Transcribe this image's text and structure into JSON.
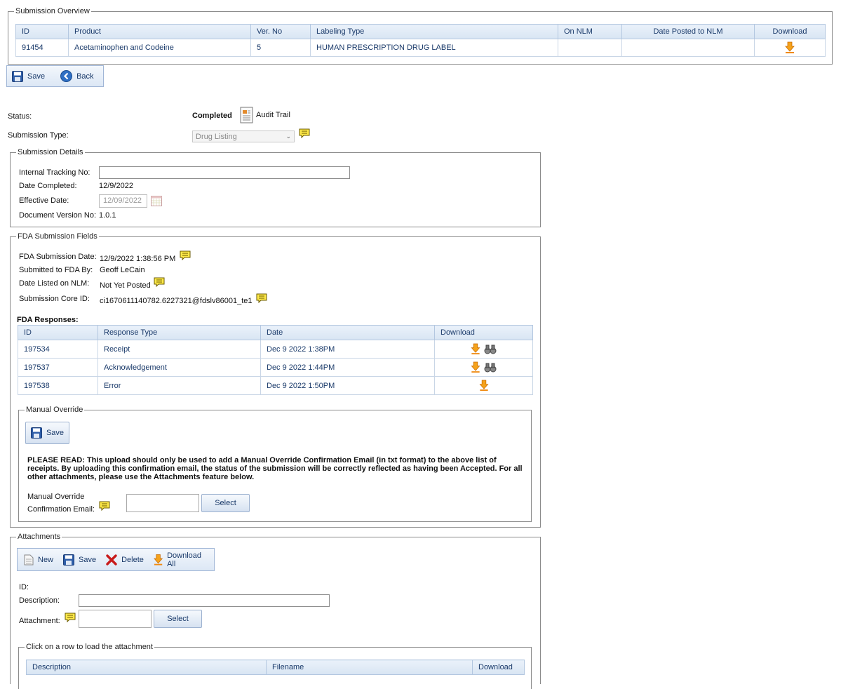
{
  "overview": {
    "legend": "Submission Overview",
    "headers": [
      "ID",
      "Product",
      "Ver. No",
      "Labeling Type",
      "On NLM",
      "Date Posted to NLM",
      "Download"
    ],
    "row": {
      "id": "91454",
      "product": "Acetaminophen and Codeine",
      "ver": "5",
      "labeling_type": "HUMAN PRESCRIPTION DRUG LABEL",
      "on_nlm": "",
      "date_posted": ""
    }
  },
  "top_toolbar": {
    "save": "Save",
    "back": "Back"
  },
  "status": {
    "label": "Status:",
    "value": "Completed",
    "audit_trail": "Audit Trail"
  },
  "submission_type": {
    "label": "Submission Type:",
    "value": "Drug Listing"
  },
  "details": {
    "legend": "Submission Details",
    "tracking_label": "Internal Tracking No:",
    "tracking_value": "",
    "date_completed_label": "Date Completed:",
    "date_completed": "12/9/2022",
    "effective_label": "Effective Date:",
    "effective_value": "12/09/2022",
    "doc_version_label": "Document Version No:",
    "doc_version": "1.0.1"
  },
  "fda": {
    "legend": "FDA Submission Fields",
    "submission_date_label": "FDA Submission Date:",
    "submission_date": "12/9/2022 1:38:56 PM",
    "submitted_by_label": "Submitted to FDA By:",
    "submitted_by": "Geoff LeCain",
    "nlm_label": "Date Listed on NLM:",
    "nlm_value": "Not Yet Posted",
    "core_id_label": "Submission Core ID:",
    "core_id": "ci1670611140782.6227321@fdslv86001_te1",
    "responses_title": "FDA Responses:",
    "responses_headers": [
      "ID",
      "Response Type",
      "Date",
      "Download"
    ],
    "responses": [
      {
        "id": "197534",
        "type": "Receipt",
        "date": "Dec 9 2022 1:38PM"
      },
      {
        "id": "197537",
        "type": "Acknowledgement",
        "date": "Dec 9 2022 1:44PM"
      },
      {
        "id": "197538",
        "type": "Error",
        "date": "Dec 9 2022 1:50PM"
      }
    ]
  },
  "manual_override": {
    "legend": "Manual Override",
    "save": "Save",
    "notice": "PLEASE READ: This upload should only be used to add a Manual Override Confirmation Email (in txt format) to the above list of receipts. By uploading this confirmation email, the status of the submission will be correctly reflected as having been Accepted. For all other attachments, please use the Attachments feature below.",
    "label_line1": "Manual Override",
    "label_line2": "Confirmation Email:",
    "select": "Select"
  },
  "attachments": {
    "legend": "Attachments",
    "toolbar": {
      "new": "New",
      "save": "Save",
      "delete": "Delete",
      "download_all": "Download All"
    },
    "id_label": "ID:",
    "description_label": "Description:",
    "attachment_label": "Attachment:",
    "select": "Select",
    "list_legend": "Click on a row to load the attachment",
    "list_headers": [
      "Description",
      "Filename",
      "Download"
    ]
  },
  "colors": {
    "accent": "#1a3a6a",
    "header_bg": "#dce7f5",
    "download_orange": "#f08a10",
    "note_yellow": "#ffe94a"
  }
}
